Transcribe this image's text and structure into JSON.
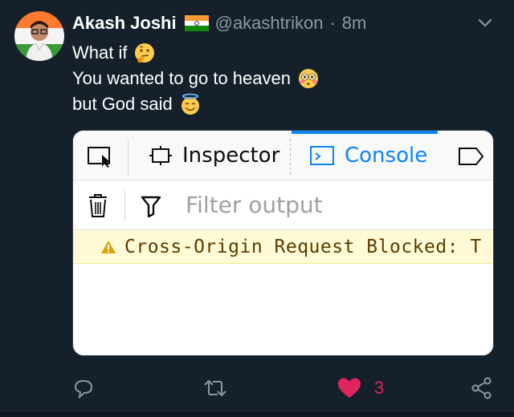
{
  "tweet": {
    "author_name": "Akash Joshi",
    "handle": "@akashtrikon",
    "separator": "·",
    "time": "8m",
    "lines": [
      "What if",
      "You wanted to go to heaven",
      "but God said"
    ],
    "icons": {
      "flag": "india-flag-icon",
      "line1_emoji": "thinking-face-icon",
      "line2_emoji": "flushed-face-icon",
      "line3_emoji": "smiling-face-with-halo-icon",
      "menu": "chevron-down-icon"
    }
  },
  "devtools": {
    "tabs": {
      "inspector": "Inspector",
      "console": "Console"
    },
    "filter_placeholder": "Filter output",
    "warning_text": "Cross-Origin Request Blocked: T"
  },
  "actions": {
    "like_count": "3"
  },
  "colors": {
    "background": "#15202b",
    "muted_text": "#8899a6",
    "like": "#e0245e",
    "console_accent": "#0a84ff",
    "warning_bg": "#fffbd6"
  }
}
